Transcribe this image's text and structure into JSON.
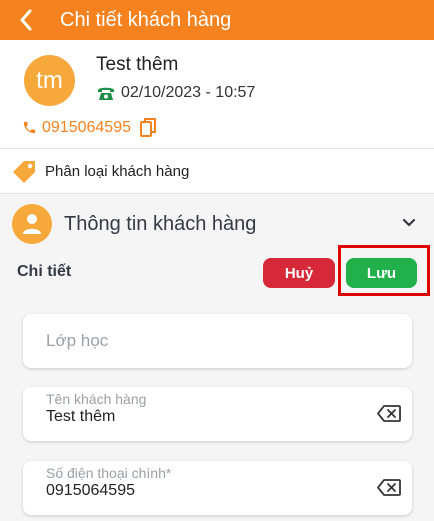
{
  "header": {
    "title": "Chi tiết khách hàng",
    "back_icon": "chevron-left-icon"
  },
  "profile": {
    "avatar_initials": "tm",
    "name": "Test thêm",
    "created_at": "02/10/2023 - 10:57",
    "phone": "0915064595",
    "phone_icon": "phone-icon",
    "date_icon": "telephone-icon",
    "copy_icon": "copy-icon"
  },
  "classify": {
    "label": "Phân loại khách hàng",
    "icon": "tag-icon"
  },
  "section": {
    "title": "Thông tin khách hàng",
    "icon": "user-icon",
    "toggle_icon": "chevron-down-icon"
  },
  "detail": {
    "label": "Chi tiết",
    "cancel_label": "Huỷ",
    "save_label": "Lưu"
  },
  "form": {
    "class_placeholder": "Lớp học",
    "name_label": "Tên khách hàng",
    "name_value": "Test thêm",
    "phone_label": "Số điện thoại chính*",
    "phone_value": "0915064595"
  },
  "colors": {
    "primary": "#f5821f",
    "avatar": "#f7a83a",
    "cancel": "#d62839",
    "save": "#22b04b",
    "highlight": "#e00000"
  }
}
